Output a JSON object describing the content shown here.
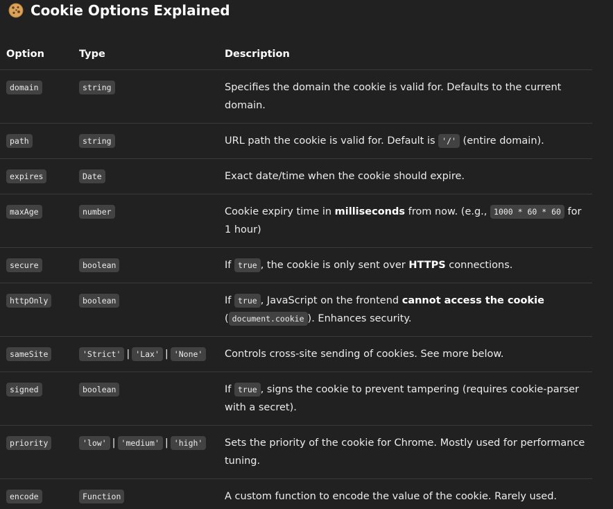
{
  "heading": "Cookie Options Explained",
  "headers": [
    "Option",
    "Type",
    "Description"
  ],
  "rows": [
    {
      "option": "domain",
      "types": [
        "string"
      ],
      "desc": [
        {
          "t": "text",
          "v": "Specifies the domain the cookie is valid for. Defaults to the current domain."
        }
      ]
    },
    {
      "option": "path",
      "types": [
        "string"
      ],
      "desc": [
        {
          "t": "text",
          "v": "URL path the cookie is valid for. Default is "
        },
        {
          "t": "code",
          "v": "'/'"
        },
        {
          "t": "text",
          "v": " (entire domain)."
        }
      ]
    },
    {
      "option": "expires",
      "types": [
        "Date"
      ],
      "desc": [
        {
          "t": "text",
          "v": "Exact date/time when the cookie should expire."
        }
      ]
    },
    {
      "option": "maxAge",
      "types": [
        "number"
      ],
      "desc": [
        {
          "t": "text",
          "v": "Cookie expiry time in "
        },
        {
          "t": "bold",
          "v": "milliseconds"
        },
        {
          "t": "text",
          "v": " from now. (e.g., "
        },
        {
          "t": "code",
          "v": "1000 * 60 * 60"
        },
        {
          "t": "text",
          "v": " for 1 hour)"
        }
      ]
    },
    {
      "option": "secure",
      "types": [
        "boolean"
      ],
      "desc": [
        {
          "t": "text",
          "v": "If "
        },
        {
          "t": "code",
          "v": "true"
        },
        {
          "t": "text",
          "v": ", the cookie is only sent over "
        },
        {
          "t": "bold",
          "v": "HTTPS"
        },
        {
          "t": "text",
          "v": " connections."
        }
      ]
    },
    {
      "option": "httpOnly",
      "types": [
        "boolean"
      ],
      "desc": [
        {
          "t": "text",
          "v": "If "
        },
        {
          "t": "code",
          "v": "true"
        },
        {
          "t": "text",
          "v": ", JavaScript on the frontend "
        },
        {
          "t": "bold",
          "v": "cannot access the cookie"
        },
        {
          "t": "text",
          "v": " ("
        },
        {
          "t": "code",
          "v": "document.cookie"
        },
        {
          "t": "text",
          "v": "). Enhances security."
        }
      ]
    },
    {
      "option": "sameSite",
      "types": [
        "'Strict'",
        "'Lax'",
        "'None'"
      ],
      "desc": [
        {
          "t": "text",
          "v": "Controls cross-site sending of cookies. See more below."
        }
      ]
    },
    {
      "option": "signed",
      "types": [
        "boolean"
      ],
      "desc": [
        {
          "t": "text",
          "v": "If "
        },
        {
          "t": "code",
          "v": "true"
        },
        {
          "t": "text",
          "v": ", signs the cookie to prevent tampering (requires cookie-parser with a secret)."
        }
      ]
    },
    {
      "option": "priority",
      "types": [
        "'low'",
        "'medium'",
        "'high'"
      ],
      "desc": [
        {
          "t": "text",
          "v": "Sets the priority of the cookie for Chrome. Mostly used for performance tuning."
        }
      ]
    },
    {
      "option": "encode",
      "types": [
        "Function"
      ],
      "desc": [
        {
          "t": "text",
          "v": "A custom function to encode the value of the cookie. Rarely used."
        }
      ]
    }
  ],
  "type_separator": "|",
  "icons": {
    "heading": "cookie-icon"
  }
}
